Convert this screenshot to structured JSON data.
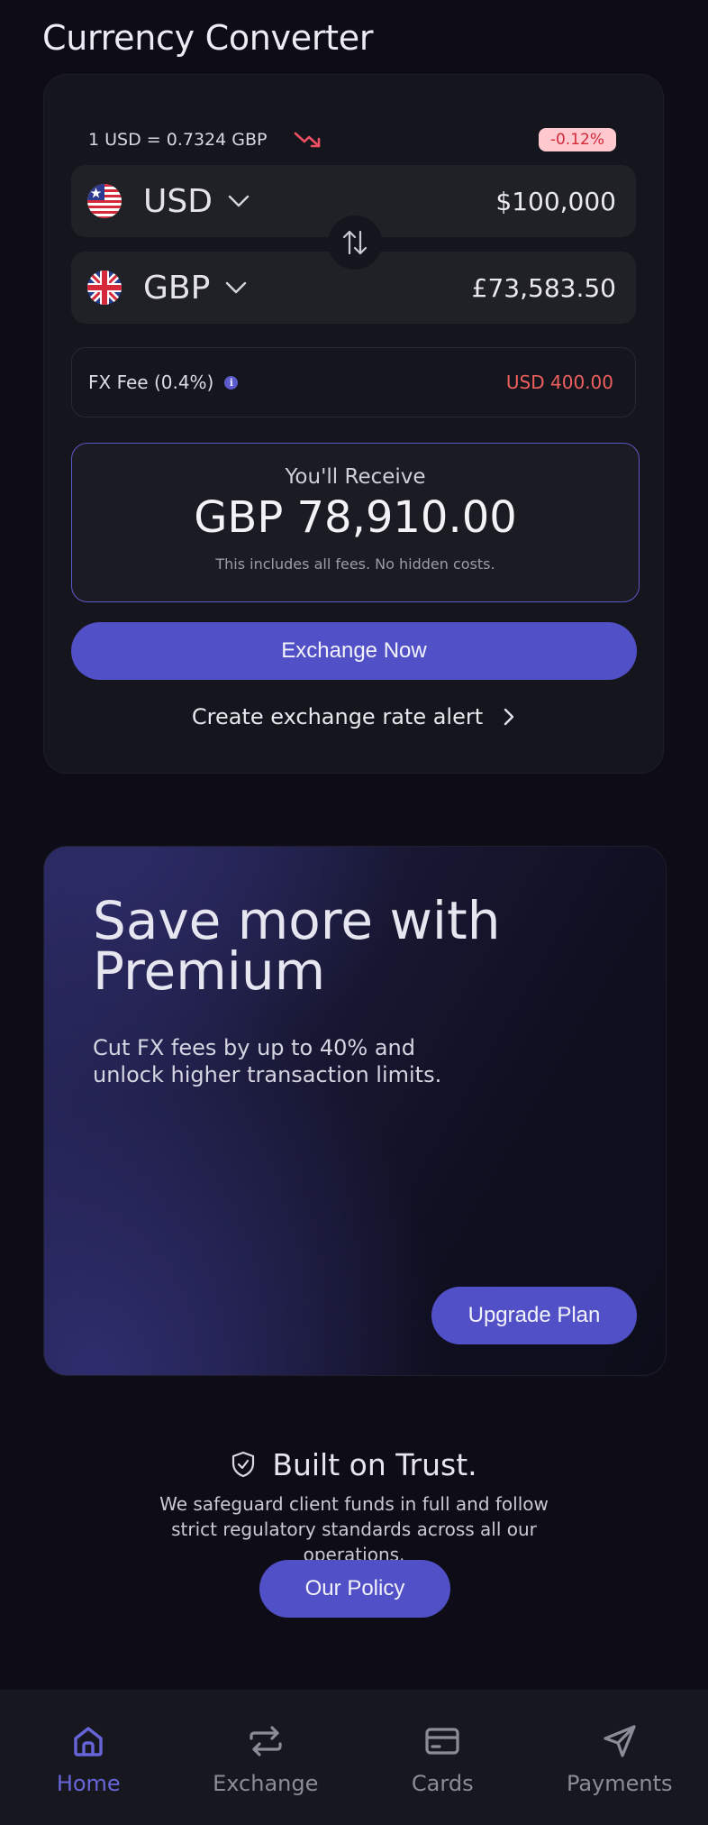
{
  "header": {
    "title": "Currency Converter"
  },
  "converter": {
    "rate_text": "1 USD = 0.7324 GBP",
    "rate_change": "-0.12%",
    "from": {
      "currency": "USD",
      "amount": "$100,000"
    },
    "to": {
      "currency": "GBP",
      "amount": "£73,583.50"
    },
    "fee_label": "FX Fee (0.4%)",
    "fee_value": "USD 400.00",
    "receive_label": "You'll Receive",
    "receive_amount": "GBP 78,910.00",
    "receive_note": "This includes all fees. No hidden costs.",
    "exchange_button": "Exchange Now",
    "alert_link": "Create exchange rate alert"
  },
  "premium": {
    "title": "Save more with Premium",
    "text": "Cut FX fees by up to 40% and unlock higher transaction limits.",
    "button": "Upgrade Plan"
  },
  "trust": {
    "title": "Built on Trust.",
    "text": "We safeguard client funds in full and follow strict regulatory standards across all our operations.",
    "button": "Our Policy"
  },
  "nav": {
    "items": [
      {
        "label": "Home",
        "icon": "home-icon",
        "active": true
      },
      {
        "label": "Exchange",
        "icon": "exchange-icon",
        "active": false
      },
      {
        "label": "Cards",
        "icon": "card-icon",
        "active": false
      },
      {
        "label": "Payments",
        "icon": "send-icon",
        "active": false
      }
    ]
  },
  "colors": {
    "accent": "#5250c6",
    "background": "#0d0c17",
    "card": "#15161d",
    "negative": "#ee5f5f",
    "badge_bg": "#ffc9cf"
  }
}
